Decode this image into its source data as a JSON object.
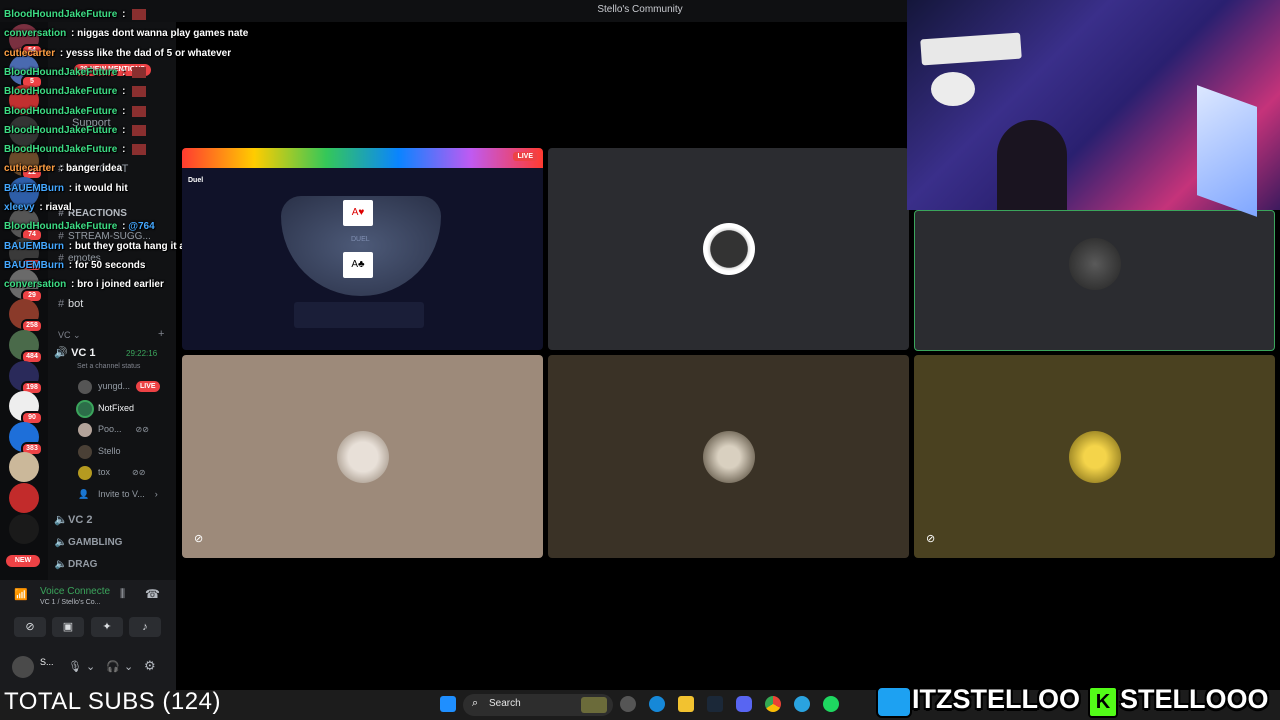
{
  "window": {
    "title": "Stello's Community"
  },
  "chat": [
    {
      "user": "BloodHoundJakeFuture",
      "color": "#3ddc84",
      "text": ""
    },
    {
      "user": "conversation",
      "color": "#3ddc84",
      "text": "niggas dont wanna play games nate"
    },
    {
      "user": "cutiecarter",
      "color": "#ff9f43",
      "text": "yesss like the dad of 5 or whatever"
    },
    {
      "user": "BloodHoundJakeFuture",
      "color": "#3ddc84",
      "text": ""
    },
    {
      "user": "BloodHoundJakeFuture",
      "color": "#3ddc84",
      "text": ""
    },
    {
      "user": "BloodHoundJakeFuture",
      "color": "#3ddc84",
      "text": ""
    },
    {
      "user": "BloodHoundJakeFuture",
      "color": "#3ddc84",
      "text": ""
    },
    {
      "user": "BloodHoundJakeFuture",
      "color": "#3ddc84",
      "text": ""
    },
    {
      "user": "cutiecarter",
      "color": "#ff9f43",
      "text": "banger idea"
    },
    {
      "user": "BAUEMBurn",
      "color": "#45a8ff",
      "text": "it would hit"
    },
    {
      "user": "xleevy",
      "color": "#45a8ff",
      "text": "riaval"
    },
    {
      "user": "BloodHoundJakeFuture",
      "color": "#3ddc84",
      "text": "@764"
    },
    {
      "user": "BAUEMBurn",
      "color": "#45a8ff",
      "text": "but they gotta hang it at the end"
    },
    {
      "user": "BAUEMBurn",
      "color": "#45a8ff",
      "text": "for 50 seconds"
    },
    {
      "user": "conversation",
      "color": "#3ddc84",
      "text": "bro i joined earlier"
    }
  ],
  "servers": [
    {
      "badge": "54"
    },
    {
      "badge": "5"
    },
    {
      "badge": ""
    },
    {
      "badge": ""
    },
    {
      "badge": "22"
    },
    {
      "badge": ""
    },
    {
      "badge": "74"
    },
    {
      "badge": "2"
    },
    {
      "badge": "29"
    },
    {
      "badge": "258"
    },
    {
      "badge": "484"
    },
    {
      "badge": "198"
    },
    {
      "badge": "90"
    },
    {
      "badge": "383"
    },
    {
      "badge": ""
    },
    {
      "badge": ""
    },
    {
      "badge": ""
    }
  ],
  "new_pill": "NEW",
  "mentions_pill": "29 NEW MENTIONS",
  "channels": {
    "support": "Support",
    "main_chat": "MAIN-CHAT",
    "reactions": "REACTIONS",
    "stream_sugg": "STREAM-SUGG...",
    "emotes": "emotes",
    "bot": "bot",
    "vc_category": "VC",
    "vc1": "VC 1",
    "vc1_timer": "29:22:16",
    "vc1_status": "Set a channel status",
    "vc_users": [
      "yungd...",
      "NotFixed",
      "Poo...",
      "Stello",
      "tox"
    ],
    "live": "LIVE",
    "invite": "Invite to V...",
    "vc2": "VC 2",
    "gambling": "GAMBLING",
    "drag": "DRAG"
  },
  "voice_panel": {
    "status": "Voice Connecte",
    "channel": "VC 1 / Stello's Co...",
    "user": "S..."
  },
  "grid": {
    "screen_live": "LIVE",
    "duel_logo": "Duel",
    "duel_table": "DUEL"
  },
  "taskbar": {
    "search_label": "Search",
    "subs": "TOTAL SUBS (124)"
  },
  "social": {
    "twitter": "ITZSTELLOO",
    "kick": "STELLOOO"
  },
  "colors": {
    "discord_bg": "#111214",
    "tile_cat": "#9d8a7a",
    "tile_dark": "#3a3226",
    "tile_gold": "#4a4120",
    "speaking_border": "#3ba55c"
  }
}
